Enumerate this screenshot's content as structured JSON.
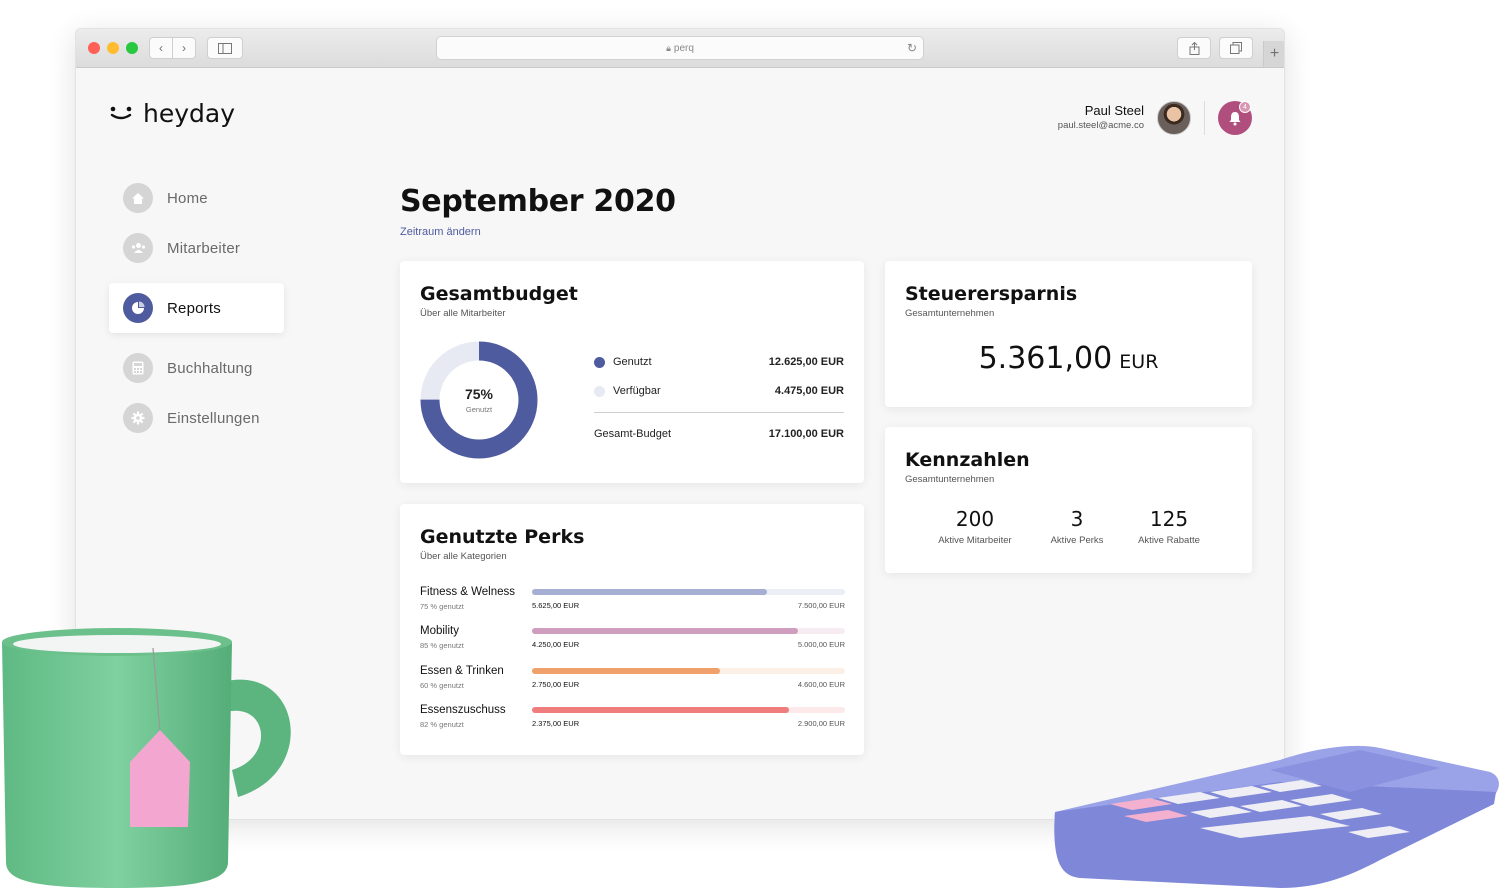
{
  "browser": {
    "url": "perq"
  },
  "app": {
    "logo_mark": "ᐛ",
    "logo_text": "heyday"
  },
  "user": {
    "name": "Paul Steel",
    "email": "paul.steel@acme.co",
    "notifications": "4"
  },
  "nav": {
    "items": [
      {
        "label": "Home",
        "icon": "home-icon"
      },
      {
        "label": "Mitarbeiter",
        "icon": "people-icon"
      },
      {
        "label": "Reports",
        "icon": "pie-chart-icon",
        "active": true
      },
      {
        "label": "Buchhaltung",
        "icon": "calculator-icon"
      },
      {
        "label": "Einstellungen",
        "icon": "gear-icon"
      }
    ]
  },
  "page": {
    "title": "September 2020",
    "period_link": "Zeitraum ändern"
  },
  "budget": {
    "title": "Gesamtbudget",
    "subtitle": "Über alle Mitarbeiter",
    "donut_percent": "75%",
    "donut_label": "Genutzt",
    "used_fraction": 0.75,
    "rows": [
      {
        "label": "Genutzt",
        "value": "12.625,00 EUR",
        "color": "#4f5b9f"
      },
      {
        "label": "Verfügbar",
        "value": "4.475,00 EUR",
        "color": "#e8eaf3"
      }
    ],
    "total_label": "Gesamt-Budget",
    "total_value": "17.100,00 EUR"
  },
  "tax": {
    "title": "Steuerersparnis",
    "subtitle": "Gesamtunternehmen",
    "value": "5.361,00",
    "currency": "EUR"
  },
  "kpis": {
    "title": "Kennzahlen",
    "subtitle": "Gesamtunternehmen",
    "items": [
      {
        "value": "200",
        "label": "Aktive Mitarbeiter"
      },
      {
        "value": "3",
        "label": "Aktive Perks"
      },
      {
        "value": "125",
        "label": "Aktive Rabatte"
      }
    ]
  },
  "perks": {
    "title": "Genutzte Perks",
    "subtitle": "Über alle Kategorien",
    "items": [
      {
        "name": "Fitness & Welness",
        "pct_text": "75 % genutzt",
        "used": "5.625,00 EUR",
        "total": "7.500,00 EUR",
        "fraction": 0.75,
        "color": "#a6aed3",
        "track": "#eceef6"
      },
      {
        "name": "Mobility",
        "pct_text": "85 % genutzt",
        "used": "4.250,00 EUR",
        "total": "5.000,00 EUR",
        "fraction": 0.85,
        "color": "#cf9dbd",
        "track": "#f6ecf2"
      },
      {
        "name": "Essen & Trinken",
        "pct_text": "60 % genutzt",
        "used": "2.750,00 EUR",
        "total": "4.600,00 EUR",
        "fraction": 0.6,
        "color": "#f0a06b",
        "track": "#fcefe6"
      },
      {
        "name": "Essenszuschuss",
        "pct_text": "82 % genutzt",
        "used": "2.375,00 EUR",
        "total": "2.900,00 EUR",
        "fraction": 0.82,
        "color": "#f07d7d",
        "track": "#fde9e9"
      }
    ]
  }
}
